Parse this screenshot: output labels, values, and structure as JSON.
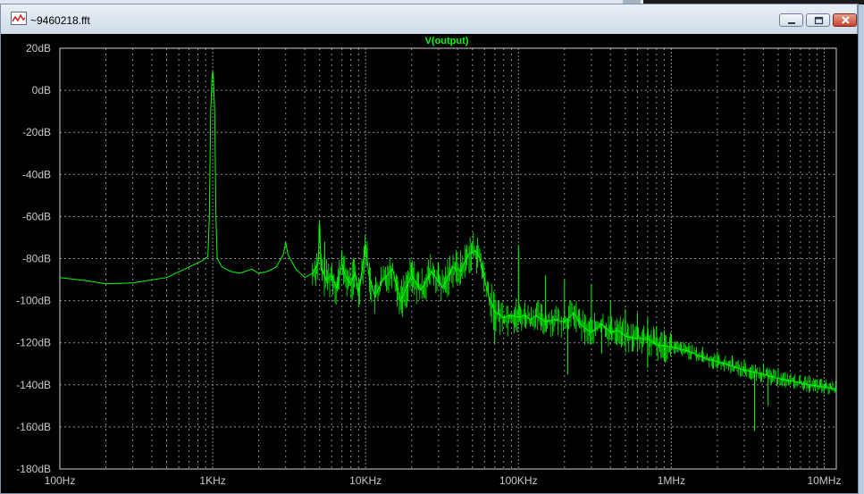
{
  "window": {
    "title": "~9460218.fft",
    "icon": "waveform-icon",
    "buttons": [
      "minimize-icon",
      "maximize-icon",
      "close-icon"
    ]
  },
  "colors": {
    "background": "#000000",
    "grid": "#8c8c8c",
    "trace": "#00ff00",
    "axis_text": "#c8c8c8"
  },
  "chart_data": {
    "type": "line",
    "title": "V(output)",
    "xscale": "log",
    "xlim": [
      100,
      12000000
    ],
    "ylim": [
      -180,
      20
    ],
    "yticks": [
      20,
      0,
      -20,
      -40,
      -60,
      -80,
      -100,
      -120,
      -140,
      -160,
      -180
    ],
    "ytick_labels": [
      "20dB",
      "0dB",
      "-20dB",
      "-40dB",
      "-60dB",
      "-80dB",
      "-100dB",
      "-120dB",
      "-140dB",
      "-160dB",
      "-180dB"
    ],
    "xticks": [
      100,
      1000,
      10000,
      100000,
      1000000,
      10000000
    ],
    "xtick_labels": [
      "100Hz",
      "1KHz",
      "10KHz",
      "100KHz",
      "1MHz",
      "10MHz"
    ],
    "grid": true,
    "series": [
      {
        "name": "V(output)",
        "points": [
          [
            100,
            -89
          ],
          [
            150,
            -90.5
          ],
          [
            200,
            -92
          ],
          [
            300,
            -91.5
          ],
          [
            500,
            -89
          ],
          [
            700,
            -84
          ],
          [
            850,
            -81
          ],
          [
            930,
            -79
          ],
          [
            950,
            -60
          ],
          [
            970,
            -10
          ],
          [
            990,
            6
          ],
          [
            1000,
            9
          ],
          [
            1010,
            6
          ],
          [
            1030,
            -10
          ],
          [
            1050,
            -60
          ],
          [
            1070,
            -80
          ],
          [
            1150,
            -84
          ],
          [
            1300,
            -86
          ],
          [
            1500,
            -87
          ],
          [
            1800,
            -85
          ],
          [
            2000,
            -87
          ],
          [
            2300,
            -86
          ],
          [
            2600,
            -84
          ],
          [
            2900,
            -78
          ],
          [
            3000,
            -72
          ],
          [
            3100,
            -78
          ],
          [
            3500,
            -85
          ],
          [
            4000,
            -89
          ],
          [
            4500,
            -87
          ],
          [
            4900,
            -82
          ],
          [
            5000,
            -62
          ],
          [
            5100,
            -84
          ],
          [
            5500,
            -90
          ],
          [
            6000,
            -88
          ],
          [
            6500,
            -94
          ],
          [
            7000,
            -82
          ],
          [
            7300,
            -88
          ],
          [
            8000,
            -92
          ],
          [
            8500,
            -87
          ],
          [
            9000,
            -96
          ],
          [
            9500,
            -85
          ],
          [
            10000,
            -73
          ],
          [
            10500,
            -88
          ],
          [
            11500,
            -98
          ],
          [
            13000,
            -90
          ],
          [
            15000,
            -85
          ],
          [
            17000,
            -100
          ],
          [
            20000,
            -88
          ],
          [
            23000,
            -95
          ],
          [
            27000,
            -86
          ],
          [
            32000,
            -94
          ],
          [
            37000,
            -84
          ],
          [
            42000,
            -86
          ],
          [
            47000,
            -78
          ],
          [
            52000,
            -76
          ],
          [
            56000,
            -80
          ],
          [
            60000,
            -90
          ],
          [
            65000,
            -100
          ],
          [
            70000,
            -105
          ],
          [
            80000,
            -108
          ],
          [
            90000,
            -107
          ],
          [
            100000,
            -108
          ],
          [
            110000,
            -107
          ],
          [
            120000,
            -109
          ],
          [
            130000,
            -107
          ],
          [
            150000,
            -110
          ],
          [
            170000,
            -109
          ],
          [
            200000,
            -110
          ],
          [
            230000,
            -106
          ],
          [
            260000,
            -112
          ],
          [
            300000,
            -115
          ],
          [
            350000,
            -111
          ],
          [
            400000,
            -115
          ],
          [
            450000,
            -114
          ],
          [
            500000,
            -117
          ],
          [
            600000,
            -118
          ],
          [
            700000,
            -118
          ],
          [
            800000,
            -121
          ],
          [
            1000000,
            -122
          ],
          [
            1300000,
            -124
          ],
          [
            1600000,
            -127
          ],
          [
            2000000,
            -129
          ],
          [
            2500000,
            -131
          ],
          [
            3000000,
            -133
          ],
          [
            4000000,
            -135
          ],
          [
            5000000,
            -137
          ],
          [
            6000000,
            -138
          ],
          [
            8000000,
            -140
          ],
          [
            10000000,
            -141
          ],
          [
            12000000,
            -142
          ]
        ],
        "spikes": [
          [
            5000,
            -62
          ],
          [
            5400,
            -72
          ],
          [
            7000,
            -76
          ],
          [
            10000,
            -73
          ],
          [
            15000,
            -82
          ],
          [
            20000,
            -83
          ],
          [
            30000,
            -83
          ],
          [
            100000,
            -74
          ],
          [
            150000,
            -88
          ],
          [
            200000,
            -90
          ],
          [
            300000,
            -92
          ],
          [
            400000,
            -100
          ],
          [
            500000,
            -104
          ],
          [
            600000,
            -106
          ],
          [
            700000,
            -108
          ],
          [
            800000,
            -112
          ],
          [
            900000,
            -114
          ],
          [
            1000000,
            -116
          ],
          [
            1300000,
            -120
          ],
          [
            1600000,
            -122
          ],
          [
            2000000,
            -124
          ],
          [
            2500000,
            -126
          ],
          [
            3000000,
            -128
          ],
          [
            4000000,
            -130
          ],
          [
            5000000,
            -132
          ]
        ],
        "dips": [
          [
            70000,
            -120
          ],
          [
            150000,
            -112
          ],
          [
            210000,
            -135
          ],
          [
            350000,
            -125
          ],
          [
            700000,
            -132
          ],
          [
            3500000,
            -162
          ],
          [
            4300000,
            -150
          ]
        ]
      }
    ]
  }
}
